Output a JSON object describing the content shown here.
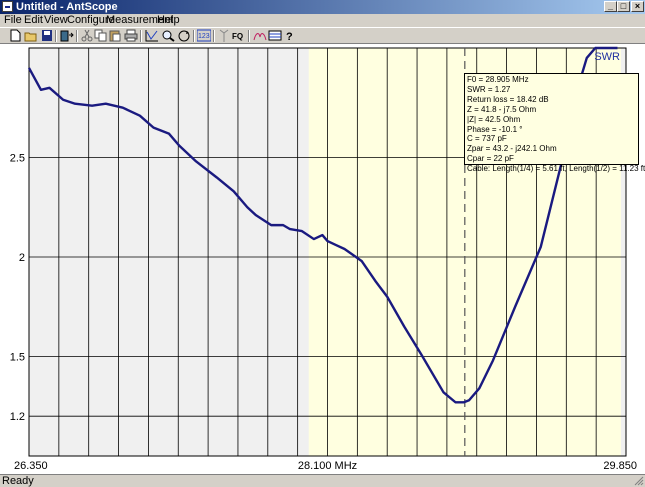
{
  "window": {
    "title": "Untitled - AntScope"
  },
  "menu": [
    "File",
    "Edit",
    "View",
    "Configure",
    "Measurement",
    "Help"
  ],
  "toolbar_icons": [
    "new-file-icon",
    "open-folder-icon",
    "save-icon",
    "device-icon",
    "cut-icon",
    "copy-icon",
    "paste-icon",
    "print-icon",
    "swr-graph-icon",
    "zoom-icon",
    "refresh-icon",
    "frequency-range-icon",
    "antenna-icon",
    "fq-icon",
    "smith-chart-icon",
    "table-icon",
    "help-icon"
  ],
  "toolbar": {
    "fq_label": "FQ",
    "range_label": "123"
  },
  "status": {
    "text": "Ready"
  },
  "tooltip": {
    "lines": [
      "F0 = 28.905 MHz",
      "SWR = 1.27",
      "Return loss = 18.42 dB",
      "Z = 41.8 - j7.5 Ohm",
      "|Z| = 42.5 Ohm",
      "Phase = -10.1 °",
      "C = 737 pF",
      "Zpar = 43.2 - j242.1 Ohm",
      "Cpar = 22 pF",
      "Cable: Length(1/4) = 5.61 ft, Length(1/2) = 11.23 ft"
    ]
  },
  "chart_data": {
    "type": "line",
    "series": [
      {
        "name": "SWR",
        "x": [
          26.35,
          26.42,
          26.47,
          26.55,
          26.62,
          26.72,
          26.8,
          26.9,
          27.0,
          27.08,
          27.17,
          27.23,
          27.33,
          27.45,
          27.55,
          27.63,
          27.68,
          27.77,
          27.84,
          27.88,
          27.95,
          28.02,
          28.07,
          28.1,
          28.15,
          28.2,
          28.3,
          28.38,
          28.45,
          28.55,
          28.65,
          28.78,
          28.85,
          28.9,
          28.93,
          28.99,
          29.07,
          29.2,
          29.35,
          29.48,
          29.55,
          29.62,
          29.67,
          29.8
        ],
        "y": [
          2.95,
          2.84,
          2.85,
          2.79,
          2.77,
          2.76,
          2.77,
          2.75,
          2.71,
          2.65,
          2.62,
          2.56,
          2.48,
          2.4,
          2.33,
          2.25,
          2.21,
          2.16,
          2.16,
          2.14,
          2.13,
          2.09,
          2.11,
          2.08,
          2.06,
          2.04,
          1.98,
          1.88,
          1.8,
          1.65,
          1.51,
          1.32,
          1.27,
          1.27,
          1.28,
          1.34,
          1.48,
          1.75,
          2.05,
          2.5,
          2.8,
          3.0,
          3.05,
          3.05
        ]
      }
    ],
    "xlim": [
      26.35,
      29.85
    ],
    "ylim": [
      1.0,
      3.05
    ],
    "x_tick_labels": [
      "26.350",
      "28.100 MHz",
      "29.850"
    ],
    "x_tick_values": [
      26.35,
      28.1,
      29.85
    ],
    "y_tick_labels": [
      "2.5",
      "2",
      "1.5",
      "1.2"
    ],
    "y_tick_values": [
      2.5,
      2.0,
      1.5,
      1.2
    ],
    "y_grid_values": [
      2.5,
      2.0,
      1.5,
      1.2
    ],
    "highlight_range": [
      27.99,
      29.82
    ],
    "cursor_x": 28.905,
    "series_label": "SWR",
    "colors": {
      "line": "#1a1a80",
      "highlight": "#ffffe0",
      "background": "#f0f0f0",
      "grid": "#000000"
    }
  }
}
